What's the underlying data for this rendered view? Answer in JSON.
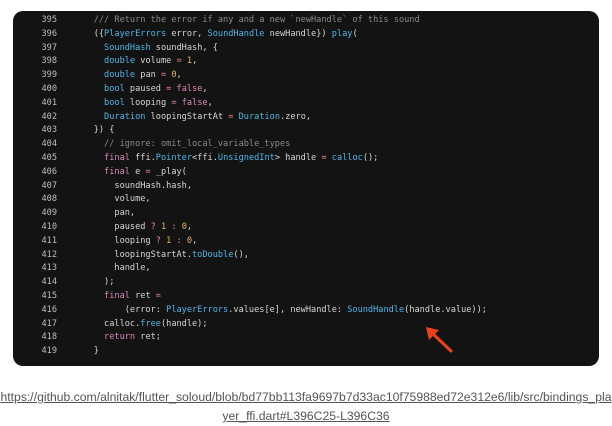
{
  "code_view": {
    "lines": [
      {
        "number": "395",
        "tokens": [
          {
            "t": "    /// Return the error if any and a new `newHandle` of this sound",
            "c": "c"
          }
        ]
      },
      {
        "number": "396",
        "tokens": [
          {
            "t": "    ({",
            "c": "p"
          },
          {
            "t": "PlayerErrors",
            "c": "t"
          },
          {
            "t": " error, ",
            "c": "p"
          },
          {
            "t": "SoundHandle",
            "c": "t"
          },
          {
            "t": " newHandle}) ",
            "c": "p"
          },
          {
            "t": "play",
            "c": "f"
          },
          {
            "t": "(",
            "c": "p"
          }
        ]
      },
      {
        "number": "397",
        "tokens": [
          {
            "t": "      ",
            "c": "p"
          },
          {
            "t": "SoundHash",
            "c": "t"
          },
          {
            "t": " soundHash, {",
            "c": "p"
          }
        ]
      },
      {
        "number": "398",
        "tokens": [
          {
            "t": "      ",
            "c": "p"
          },
          {
            "t": "double",
            "c": "t"
          },
          {
            "t": " volume ",
            "c": "p"
          },
          {
            "t": "=",
            "c": "o"
          },
          {
            "t": " ",
            "c": "p"
          },
          {
            "t": "1",
            "c": "n"
          },
          {
            "t": ",",
            "c": "p"
          }
        ]
      },
      {
        "number": "399",
        "tokens": [
          {
            "t": "      ",
            "c": "p"
          },
          {
            "t": "double",
            "c": "t"
          },
          {
            "t": " pan ",
            "c": "p"
          },
          {
            "t": "=",
            "c": "o"
          },
          {
            "t": " ",
            "c": "p"
          },
          {
            "t": "0",
            "c": "n"
          },
          {
            "t": ",",
            "c": "p"
          }
        ]
      },
      {
        "number": "400",
        "tokens": [
          {
            "t": "      ",
            "c": "p"
          },
          {
            "t": "bool",
            "c": "t"
          },
          {
            "t": " paused ",
            "c": "p"
          },
          {
            "t": "=",
            "c": "o"
          },
          {
            "t": " ",
            "c": "p"
          },
          {
            "t": "false",
            "c": "k"
          },
          {
            "t": ",",
            "c": "p"
          }
        ]
      },
      {
        "number": "401",
        "tokens": [
          {
            "t": "      ",
            "c": "p"
          },
          {
            "t": "bool",
            "c": "t"
          },
          {
            "t": " looping ",
            "c": "p"
          },
          {
            "t": "=",
            "c": "o"
          },
          {
            "t": " ",
            "c": "p"
          },
          {
            "t": "false",
            "c": "k"
          },
          {
            "t": ",",
            "c": "p"
          }
        ]
      },
      {
        "number": "402",
        "tokens": [
          {
            "t": "      ",
            "c": "p"
          },
          {
            "t": "Duration",
            "c": "t"
          },
          {
            "t": " loopingStartAt ",
            "c": "p"
          },
          {
            "t": "=",
            "c": "o"
          },
          {
            "t": " ",
            "c": "p"
          },
          {
            "t": "Duration",
            "c": "t"
          },
          {
            "t": ".zero,",
            "c": "p"
          }
        ]
      },
      {
        "number": "403",
        "tokens": [
          {
            "t": "    }) {",
            "c": "p"
          }
        ]
      },
      {
        "number": "404",
        "tokens": [
          {
            "t": "      // ignore: omit_local_variable_types",
            "c": "c"
          }
        ]
      },
      {
        "number": "405",
        "tokens": [
          {
            "t": "      ",
            "c": "p"
          },
          {
            "t": "final",
            "c": "k"
          },
          {
            "t": " ffi.",
            "c": "p"
          },
          {
            "t": "Pointer",
            "c": "t"
          },
          {
            "t": "<ffi.",
            "c": "p"
          },
          {
            "t": "UnsignedInt",
            "c": "t"
          },
          {
            "t": "> handle ",
            "c": "p"
          },
          {
            "t": "=",
            "c": "o"
          },
          {
            "t": " ",
            "c": "p"
          },
          {
            "t": "calloc",
            "c": "f"
          },
          {
            "t": "();",
            "c": "p"
          }
        ]
      },
      {
        "number": "406",
        "tokens": [
          {
            "t": "      ",
            "c": "p"
          },
          {
            "t": "final",
            "c": "k"
          },
          {
            "t": " e ",
            "c": "p"
          },
          {
            "t": "=",
            "c": "o"
          },
          {
            "t": " _play(",
            "c": "p"
          }
        ]
      },
      {
        "number": "407",
        "tokens": [
          {
            "t": "        soundHash.hash,",
            "c": "p"
          }
        ]
      },
      {
        "number": "408",
        "tokens": [
          {
            "t": "        volume,",
            "c": "p"
          }
        ]
      },
      {
        "number": "409",
        "tokens": [
          {
            "t": "        pan,",
            "c": "p"
          }
        ]
      },
      {
        "number": "410",
        "tokens": [
          {
            "t": "        paused ",
            "c": "p"
          },
          {
            "t": "?",
            "c": "o"
          },
          {
            "t": " ",
            "c": "p"
          },
          {
            "t": "1",
            "c": "n"
          },
          {
            "t": " ",
            "c": "p"
          },
          {
            "t": ":",
            "c": "o"
          },
          {
            "t": " ",
            "c": "p"
          },
          {
            "t": "0",
            "c": "n"
          },
          {
            "t": ",",
            "c": "p"
          }
        ]
      },
      {
        "number": "411",
        "tokens": [
          {
            "t": "        looping ",
            "c": "p"
          },
          {
            "t": "?",
            "c": "o"
          },
          {
            "t": " ",
            "c": "p"
          },
          {
            "t": "1",
            "c": "n"
          },
          {
            "t": " ",
            "c": "p"
          },
          {
            "t": ":",
            "c": "o"
          },
          {
            "t": " ",
            "c": "p"
          },
          {
            "t": "0",
            "c": "n"
          },
          {
            "t": ",",
            "c": "p"
          }
        ]
      },
      {
        "number": "412",
        "tokens": [
          {
            "t": "        loopingStartAt.",
            "c": "p"
          },
          {
            "t": "toDouble",
            "c": "f"
          },
          {
            "t": "(),",
            "c": "p"
          }
        ]
      },
      {
        "number": "413",
        "tokens": [
          {
            "t": "        handle,",
            "c": "p"
          }
        ]
      },
      {
        "number": "414",
        "tokens": [
          {
            "t": "      );",
            "c": "p"
          }
        ]
      },
      {
        "number": "415",
        "tokens": [
          {
            "t": "      ",
            "c": "p"
          },
          {
            "t": "final",
            "c": "k"
          },
          {
            "t": " ret ",
            "c": "p"
          },
          {
            "t": "=",
            "c": "o"
          }
        ]
      },
      {
        "number": "416",
        "tokens": [
          {
            "t": "          (error: ",
            "c": "p"
          },
          {
            "t": "PlayerErrors",
            "c": "t"
          },
          {
            "t": ".values[e], newHandle: ",
            "c": "p"
          },
          {
            "t": "SoundHandle",
            "c": "t"
          },
          {
            "t": "(handle.value));",
            "c": "p"
          }
        ]
      },
      {
        "number": "417",
        "tokens": [
          {
            "t": "      calloc.",
            "c": "p"
          },
          {
            "t": "free",
            "c": "f"
          },
          {
            "t": "(handle);",
            "c": "p"
          }
        ]
      },
      {
        "number": "418",
        "tokens": [
          {
            "t": "      ",
            "c": "p"
          },
          {
            "t": "return",
            "c": "k"
          },
          {
            "t": " ret;",
            "c": "p"
          }
        ]
      },
      {
        "number": "419",
        "tokens": [
          {
            "t": "    }",
            "c": "p"
          }
        ]
      }
    ]
  },
  "annotation": {
    "color": "#e8431b",
    "icon": "arrow-icon"
  },
  "source_link": {
    "text": "https://github.com/alnitak/flutter_soloud/blob/bd77bb113fa9697b7d33ac10f75988ed72e312e6/lib/src/bindings_player_ffi.dart#L396C25-L396C36"
  },
  "colors": {
    "background": "#131313",
    "type": "#4fb6e8",
    "keyword": "#d98ab8",
    "number": "#e7b36b",
    "operator": "#e98a8a",
    "comment": "#8a8a8a"
  }
}
